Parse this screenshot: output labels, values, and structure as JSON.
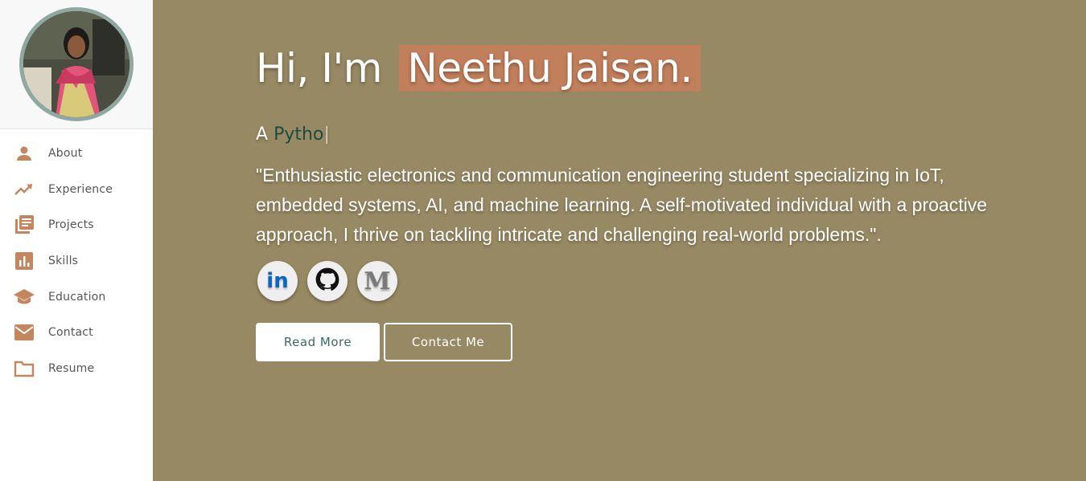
{
  "sidebar": {
    "items": [
      {
        "label": "About",
        "icon": "person-icon"
      },
      {
        "label": "Experience",
        "icon": "trending-up-icon"
      },
      {
        "label": "Projects",
        "icon": "library-books-icon"
      },
      {
        "label": "Skills",
        "icon": "bar-chart-icon"
      },
      {
        "label": "Education",
        "icon": "graduation-cap-icon"
      },
      {
        "label": "Contact",
        "icon": "mail-icon"
      },
      {
        "label": "Resume",
        "icon": "folder-icon"
      }
    ]
  },
  "hero": {
    "greeting": "Hi, I'm",
    "name": "Neethu Jaisan.",
    "typed_prefix": "A",
    "typed_text": "Pytho",
    "cursor": "|",
    "intro": "\"Enthusiastic electronics and communication engineering student specializing in IoT, embedded systems, AI, and machine learning. A self-motivated individual with a proactive approach, I thrive on tackling intricate and challenging real-world problems.\"."
  },
  "socials": [
    {
      "name": "linkedin-icon",
      "glyph": "in"
    },
    {
      "name": "github-icon"
    },
    {
      "name": "medium-icon",
      "glyph": "M"
    }
  ],
  "buttons": {
    "read_more": "Read More",
    "contact_me": "Contact Me"
  },
  "colors": {
    "background": "#978963",
    "accent": "#c27f5b",
    "sidebar_icon": "#c4865e",
    "typed_word": "#1f4a3e",
    "avatar_border": "#8fa9a2"
  }
}
